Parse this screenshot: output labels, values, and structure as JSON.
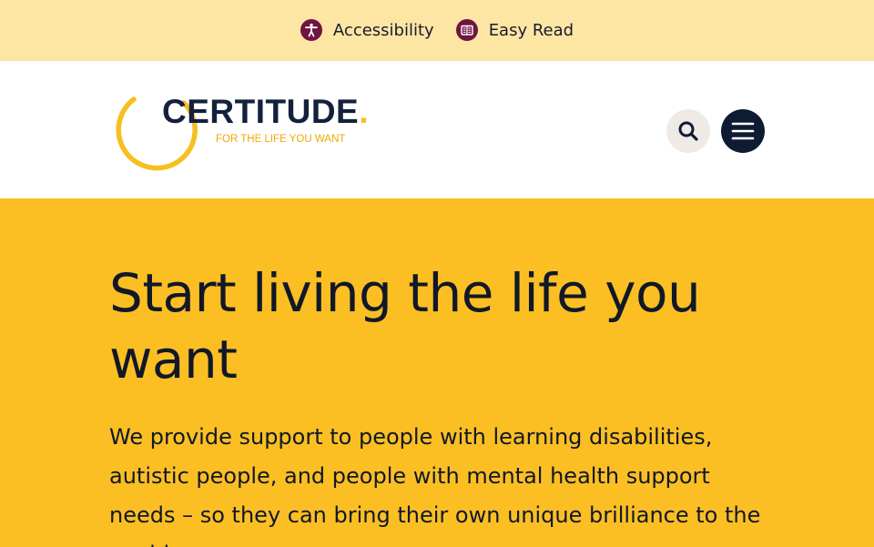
{
  "topbar": {
    "accessibility_label": "Accessibility",
    "easy_read_label": "Easy Read",
    "accessibility_icon": "accessibility-person-icon",
    "easy_read_icon": "book-icon"
  },
  "header": {
    "logo_name": "CERTITUDE",
    "logo_dot": ".",
    "logo_tagline": "FOR THE LIFE YOU WANT",
    "search_icon": "search-icon",
    "menu_icon": "hamburger-menu-icon"
  },
  "hero": {
    "title": "Start living the life you want",
    "body": "We provide support to people with learning disabilities, autistic people, and people with mental health support needs – so they can bring their own unique brilliance to the world."
  },
  "colors": {
    "topbar_bg": "#fde6a4",
    "hero_bg": "#fbbf24",
    "brand_navy": "#14213d",
    "brand_yellow": "#f7bf1f",
    "badge_plum": "#6e1541"
  }
}
